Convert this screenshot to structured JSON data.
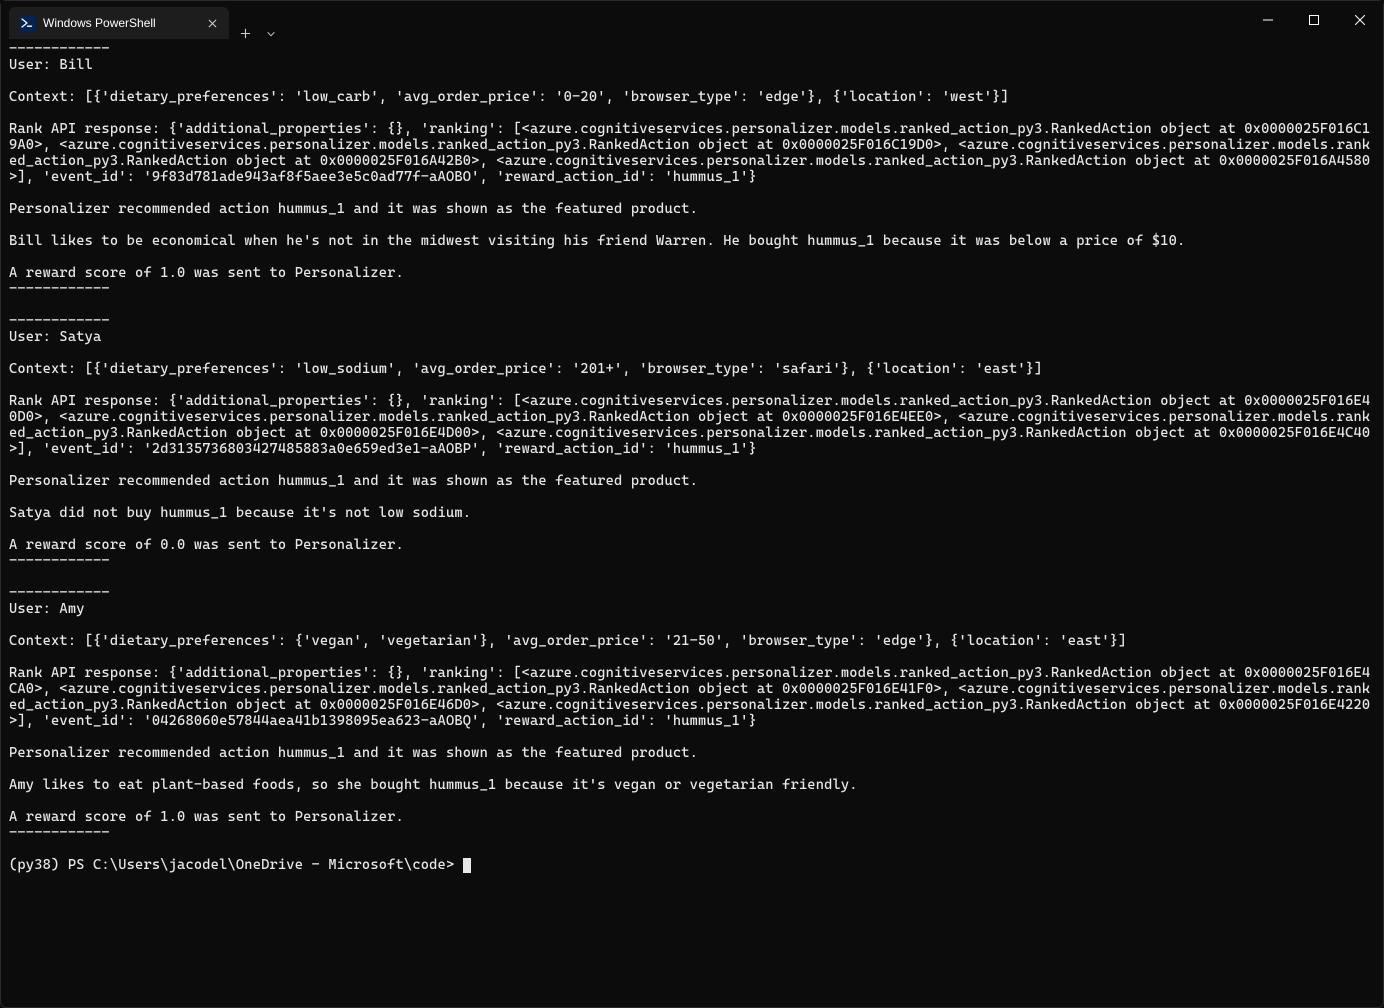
{
  "window": {
    "tab_title": "Windows PowerShell"
  },
  "term": {
    "divider_top1": "------------",
    "user_bill": "User: Bill",
    "ctx_bill": "Context: [{'dietary_preferences': 'low_carb', 'avg_order_price': '0-20', 'browser_type': 'edge'}, {'location': 'west'}]",
    "rank_bill": "Rank API response: {'additional_properties': {}, 'ranking': [<azure.cognitiveservices.personalizer.models.ranked_action_py3.RankedAction object at 0x0000025F016C19A0>, <azure.cognitiveservices.personalizer.models.ranked_action_py3.RankedAction object at 0x0000025F016C19D0>, <azure.cognitiveservices.personalizer.models.ranked_action_py3.RankedAction object at 0x0000025F016A42B0>, <azure.cognitiveservices.personalizer.models.ranked_action_py3.RankedAction object at 0x0000025F016A4580>], 'event_id': '9f83d781ade943af8f5aee3e5c0ad77f-aAOBO', 'reward_action_id': 'hummus_1'}",
    "rec_bill": "Personalizer recommended action hummus_1 and it was shown as the featured product.",
    "story_bill": "Bill likes to be economical when he's not in the midwest visiting his friend Warren. He bought hummus_1 because it was below a price of $10.",
    "reward_bill": "A reward score of 1.0 was sent to Personalizer.",
    "divider_end1": "------------",
    "divider_top2": "------------",
    "user_satya": "User: Satya",
    "ctx_satya": "Context: [{'dietary_preferences': 'low_sodium', 'avg_order_price': '201+', 'browser_type': 'safari'}, {'location': 'east'}]",
    "rank_satya": "Rank API response: {'additional_properties': {}, 'ranking': [<azure.cognitiveservices.personalizer.models.ranked_action_py3.RankedAction object at 0x0000025F016E40D0>, <azure.cognitiveservices.personalizer.models.ranked_action_py3.RankedAction object at 0x0000025F016E4EE0>, <azure.cognitiveservices.personalizer.models.ranked_action_py3.RankedAction object at 0x0000025F016E4D00>, <azure.cognitiveservices.personalizer.models.ranked_action_py3.RankedAction object at 0x0000025F016E4C40>], 'event_id': '2d3135736803427485883a0e659ed3e1-aAOBP', 'reward_action_id': 'hummus_1'}",
    "rec_satya": "Personalizer recommended action hummus_1 and it was shown as the featured product.",
    "story_satya": "Satya did not buy hummus_1 because it's not low sodium.",
    "reward_satya": "A reward score of 0.0 was sent to Personalizer.",
    "divider_end2": "------------",
    "divider_top3": "------------",
    "user_amy": "User: Amy",
    "ctx_amy": "Context: [{'dietary_preferences': {'vegan', 'vegetarian'}, 'avg_order_price': '21-50', 'browser_type': 'edge'}, {'location': 'east'}]",
    "rank_amy": "Rank API response: {'additional_properties': {}, 'ranking': [<azure.cognitiveservices.personalizer.models.ranked_action_py3.RankedAction object at 0x0000025F016E4CA0>, <azure.cognitiveservices.personalizer.models.ranked_action_py3.RankedAction object at 0x0000025F016E41F0>, <azure.cognitiveservices.personalizer.models.ranked_action_py3.RankedAction object at 0x0000025F016E46D0>, <azure.cognitiveservices.personalizer.models.ranked_action_py3.RankedAction object at 0x0000025F016E4220>], 'event_id': '04268060e57844aea41b1398095ea623-aAOBQ', 'reward_action_id': 'hummus_1'}",
    "rec_amy": "Personalizer recommended action hummus_1 and it was shown as the featured product.",
    "story_amy": "Amy likes to eat plant-based foods, so she bought hummus_1 because it's vegan or vegetarian friendly.",
    "reward_amy": "A reward score of 1.0 was sent to Personalizer.",
    "divider_end3": "------------",
    "prompt": "(py38) PS C:\\Users\\jacodel\\OneDrive - Microsoft\\code> "
  }
}
